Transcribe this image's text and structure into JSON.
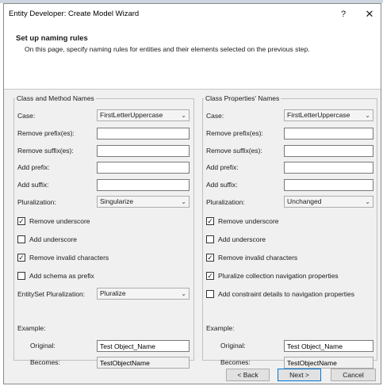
{
  "window": {
    "title": "Entity Developer: Create Model Wizard",
    "help_glyph": "?",
    "close_glyph": "✕"
  },
  "header": {
    "heading": "Set up naming rules",
    "description": "On this page, specify naming rules for entities and their elements selected on the previous step."
  },
  "class_method": {
    "legend": "Class and Method Names",
    "case_label": "Case:",
    "case_value": "FirstLetterUppercase",
    "remove_prefix_label": "Remove prefix(es):",
    "remove_prefix_value": "",
    "remove_suffix_label": "Remove suffix(es):",
    "remove_suffix_value": "",
    "add_prefix_label": "Add prefix:",
    "add_prefix_value": "",
    "add_suffix_label": "Add suffix:",
    "add_suffix_value": "",
    "pluralization_label": "Pluralization:",
    "pluralization_value": "Singularize",
    "remove_underscore": {
      "label": "Remove underscore",
      "checked": true
    },
    "add_underscore": {
      "label": "Add underscore",
      "checked": false
    },
    "remove_invalid": {
      "label": "Remove invalid characters",
      "checked": true
    },
    "add_schema": {
      "label": "Add schema as prefix",
      "checked": false
    },
    "entityset_label": "EntitySet Pluralization:",
    "entityset_value": "Pluralize",
    "example_label": "Example:",
    "original_label": "Original:",
    "original_value": "Test Object_Name",
    "becomes_label": "Becomes:",
    "becomes_value": "TestObjectName"
  },
  "class_props": {
    "legend": "Class Properties' Names",
    "case_label": "Case:",
    "case_value": "FirstLetterUppercase",
    "remove_prefix_label": "Remove prefix(es):",
    "remove_prefix_value": "",
    "remove_suffix_label": "Remove suffix(es):",
    "remove_suffix_value": "",
    "add_prefix_label": "Add prefix:",
    "add_prefix_value": "",
    "add_suffix_label": "Add suffix:",
    "add_suffix_value": "",
    "pluralization_label": "Pluralization:",
    "pluralization_value": "Unchanged",
    "remove_underscore": {
      "label": "Remove underscore",
      "checked": true
    },
    "add_underscore": {
      "label": "Add underscore",
      "checked": false
    },
    "remove_invalid": {
      "label": "Remove invalid characters",
      "checked": true
    },
    "pluralize_collection": {
      "label": "Pluralize collection navigation properties",
      "checked": true
    },
    "add_constraint": {
      "label": "Add constraint details to navigation properties",
      "checked": false
    },
    "example_label": "Example:",
    "original_label": "Original:",
    "original_value": "Test Object_Name",
    "becomes_label": "Becomes:",
    "becomes_value": "TestObjectName"
  },
  "buttons": {
    "back": "< Back",
    "next": "Next >",
    "cancel": "Cancel"
  },
  "icons": {
    "dropdown": "chevron-down-icon",
    "check": "checkmark-icon"
  },
  "colors": {
    "accent": "#0078d7",
    "dialog_bg": "#f0f0f0"
  }
}
